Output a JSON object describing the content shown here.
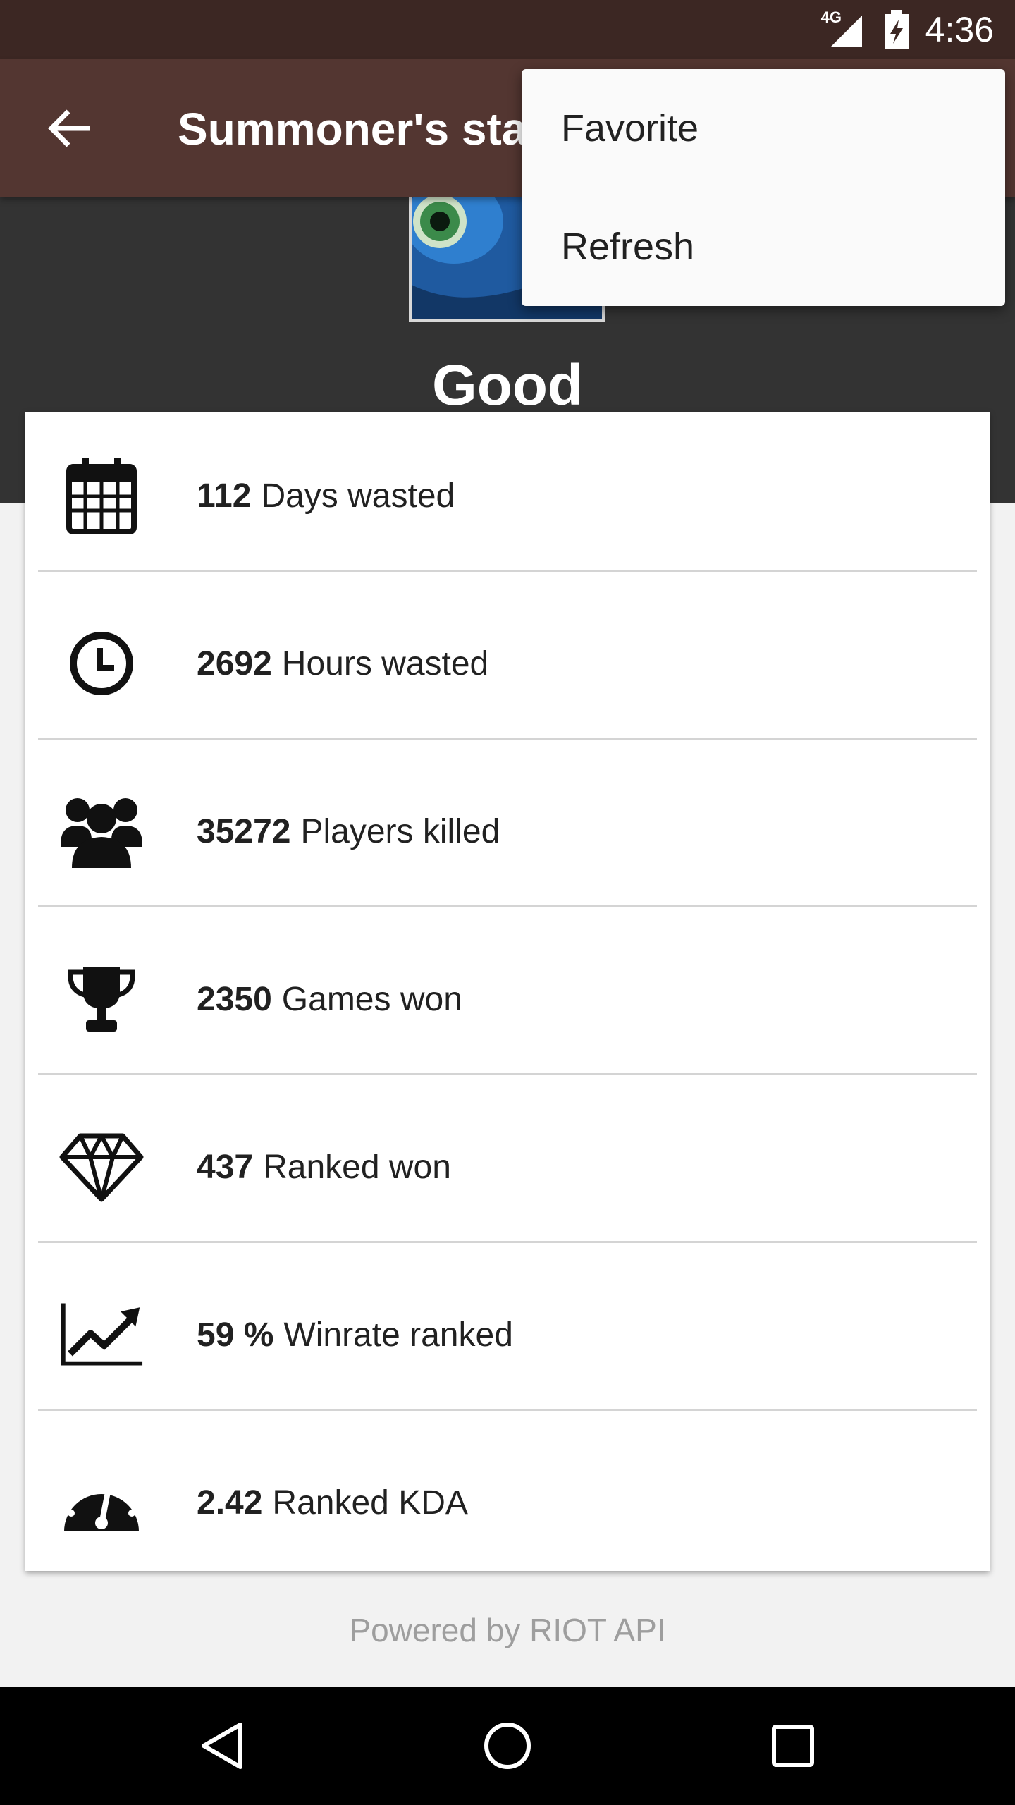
{
  "status_bar": {
    "network": "4G",
    "time": "4:36"
  },
  "app_bar": {
    "title": "Summoner's stats",
    "back_icon": "arrow-back-icon"
  },
  "profile": {
    "name": "Good"
  },
  "stats": [
    {
      "icon": "calendar-icon",
      "value": "112",
      "label": "Days wasted"
    },
    {
      "icon": "clock-icon",
      "value": "2692",
      "label": "Hours wasted"
    },
    {
      "icon": "people-icon",
      "value": "35272",
      "label": "Players killed"
    },
    {
      "icon": "trophy-icon",
      "value": "2350",
      "label": "Games won"
    },
    {
      "icon": "diamond-icon",
      "value": "437",
      "label": "Ranked won"
    },
    {
      "icon": "trending-up-icon",
      "value": "59 %",
      "label": "Winrate ranked"
    },
    {
      "icon": "speedometer-icon",
      "value": "2.42",
      "label": "Ranked KDA"
    }
  ],
  "footer": {
    "text": "Powered by RIOT API"
  },
  "menu": {
    "items": [
      "Favorite",
      "Refresh"
    ]
  },
  "colors": {
    "status_bar": "#3c2723",
    "app_bar": "#533631",
    "header": "#333333"
  }
}
